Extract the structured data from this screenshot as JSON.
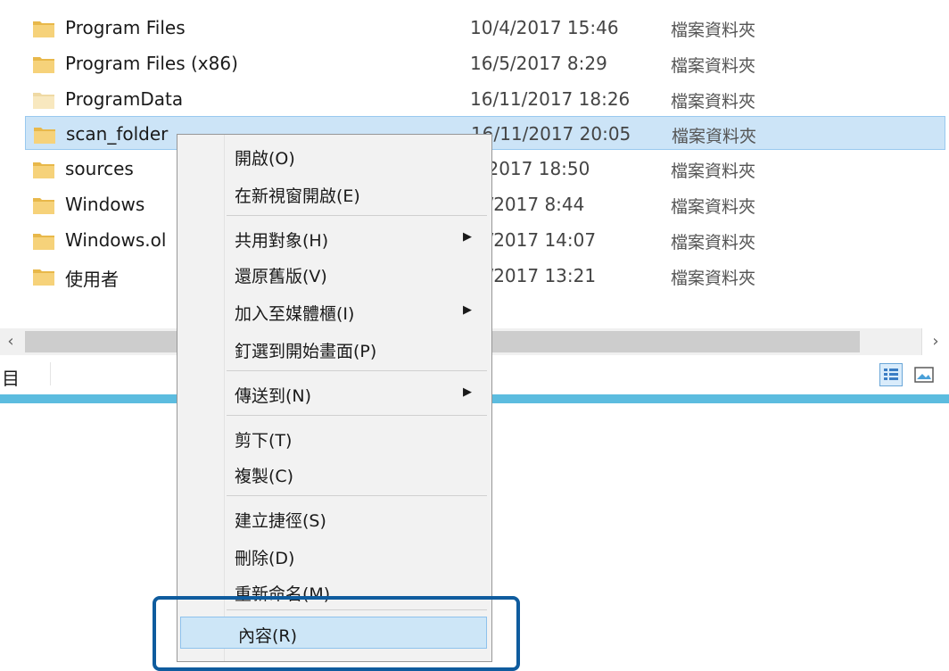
{
  "files": [
    {
      "name": "Program Files",
      "date": "10/4/2017 15:46",
      "type": "檔案資料夾",
      "selected": false
    },
    {
      "name": "Program Files (x86)",
      "date": "16/5/2017 8:29",
      "type": "檔案資料夾",
      "selected": false
    },
    {
      "name": "ProgramData",
      "date": "16/11/2017 18:26",
      "type": "檔案資料夾",
      "selected": false,
      "faded": true
    },
    {
      "name": "scan_folder",
      "date": "16/11/2017 20:05",
      "type": "檔案資料夾",
      "selected": true
    },
    {
      "name": "sources",
      "date": "2/2017 18:50",
      "type": "檔案資料夾",
      "selected": false
    },
    {
      "name": "Windows",
      "date": "/6/2017 8:44",
      "type": "檔案資料夾",
      "selected": false
    },
    {
      "name": "Windows.ol",
      "date": "/2/2017 14:07",
      "type": "檔案資料夾",
      "selected": false
    },
    {
      "name": "使用者",
      "date": "/3/2017 13:21",
      "type": "檔案資料夾",
      "selected": false
    }
  ],
  "statusbar": {
    "items_label": "目"
  },
  "context_menu": {
    "open": "開啟(O)",
    "open_new_window": "在新視窗開啟(E)",
    "share_with": "共用對象(H)",
    "restore_versions": "還原舊版(V)",
    "include_in_library": "加入至媒體櫃(I)",
    "pin_to_start": "釘選到開始畫面(P)",
    "send_to": "傳送到(N)",
    "cut": "剪下(T)",
    "copy": "複製(C)",
    "create_shortcut": "建立捷徑(S)",
    "delete": "刪除(D)",
    "rename": "重新命名(M)",
    "properties": "內容(R)"
  },
  "colors": {
    "selection": "#cce4f7",
    "accent_line": "#5cbcdf",
    "callout_border": "#0f5c9e"
  }
}
